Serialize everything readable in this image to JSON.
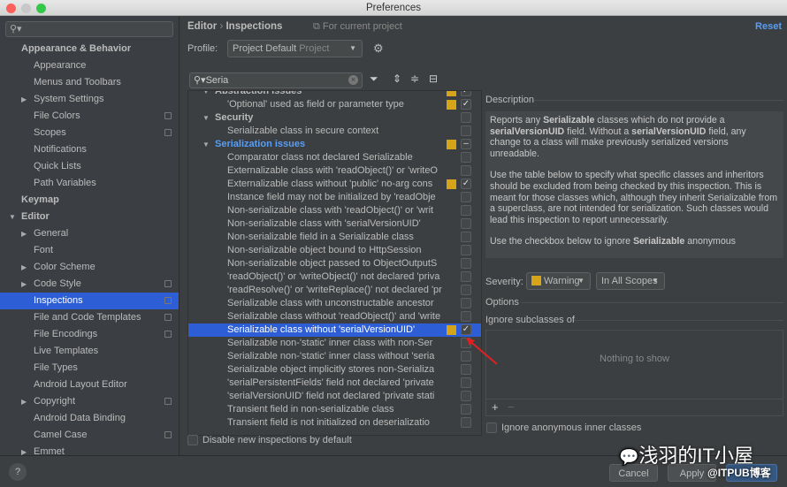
{
  "window": {
    "title": "Preferences"
  },
  "sidebar": {
    "search_placeholder": "",
    "items": [
      {
        "label": "Appearance & Behavior",
        "level": 0,
        "bold": true
      },
      {
        "label": "Appearance",
        "level": 1
      },
      {
        "label": "Menus and Toolbars",
        "level": 1
      },
      {
        "label": "System Settings",
        "level": 1,
        "expander": "closed"
      },
      {
        "label": "File Colors",
        "level": 1,
        "copy": true
      },
      {
        "label": "Scopes",
        "level": 1,
        "copy": true
      },
      {
        "label": "Notifications",
        "level": 1
      },
      {
        "label": "Quick Lists",
        "level": 1
      },
      {
        "label": "Path Variables",
        "level": 1
      },
      {
        "label": "Keymap",
        "level": 0,
        "bold": true
      },
      {
        "label": "Editor",
        "level": 0,
        "bold": true,
        "expander": "open"
      },
      {
        "label": "General",
        "level": 1,
        "expander": "closed"
      },
      {
        "label": "Font",
        "level": 1
      },
      {
        "label": "Color Scheme",
        "level": 1,
        "expander": "closed"
      },
      {
        "label": "Code Style",
        "level": 1,
        "expander": "closed",
        "copy": true
      },
      {
        "label": "Inspections",
        "level": 1,
        "copy": true,
        "selected": true
      },
      {
        "label": "File and Code Templates",
        "level": 1,
        "copy": true
      },
      {
        "label": "File Encodings",
        "level": 1,
        "copy": true
      },
      {
        "label": "Live Templates",
        "level": 1
      },
      {
        "label": "File Types",
        "level": 1
      },
      {
        "label": "Android Layout Editor",
        "level": 1
      },
      {
        "label": "Copyright",
        "level": 1,
        "expander": "closed",
        "copy": true
      },
      {
        "label": "Android Data Binding",
        "level": 1
      },
      {
        "label": "Camel Case",
        "level": 1,
        "copy": true
      },
      {
        "label": "Emmet",
        "level": 1,
        "expander": "closed"
      }
    ]
  },
  "header": {
    "crumb_parent": "Editor",
    "crumb_sep": "›",
    "crumb_current": "Inspections",
    "scope_hint": "For current project",
    "reset": "Reset"
  },
  "profile": {
    "label": "Profile:",
    "value": "Project Default",
    "scope": "Project"
  },
  "filter": {
    "search_value": "Seria"
  },
  "inspections": [
    {
      "label": "Abstraction issues",
      "group": true,
      "sev": true,
      "check": "✓"
    },
    {
      "label": "'Optional' used as field or parameter type",
      "sev": true,
      "check": "✓"
    },
    {
      "label": "Security",
      "group": true,
      "check": ""
    },
    {
      "label": "Serializable class in secure context",
      "check": ""
    },
    {
      "label": "Serialization issues",
      "group": true,
      "highlight": true,
      "sev": true,
      "check": "–"
    },
    {
      "label": "Comparator class not declared Serializable",
      "check": ""
    },
    {
      "label": "Externalizable class with 'readObject()' or 'writeO",
      "check": ""
    },
    {
      "label": "Externalizable class without 'public' no-arg cons",
      "sev": true,
      "check": "✓"
    },
    {
      "label": "Instance field may not be initialized by 'readObje",
      "check": ""
    },
    {
      "label": "Non-serializable class with 'readObject()' or 'writ",
      "check": ""
    },
    {
      "label": "Non-serializable class with 'serialVersionUID'",
      "check": ""
    },
    {
      "label": "Non-serializable field in a Serializable class",
      "check": ""
    },
    {
      "label": "Non-serializable object bound to HttpSession",
      "check": ""
    },
    {
      "label": "Non-serializable object passed to ObjectOutputS",
      "check": ""
    },
    {
      "label": "'readObject()' or 'writeObject()' not declared 'priva",
      "check": ""
    },
    {
      "label": "'readResolve()' or 'writeReplace()' not declared 'pr",
      "check": ""
    },
    {
      "label": "Serializable class with unconstructable ancestor",
      "check": ""
    },
    {
      "label": "Serializable class without 'readObject()' and 'write",
      "check": ""
    },
    {
      "label": "Serializable class without 'serialVersionUID'",
      "sev": true,
      "check": "✓",
      "selected": true
    },
    {
      "label": "Serializable non-'static' inner class with non-Ser",
      "check": ""
    },
    {
      "label": "Serializable non-'static' inner class without 'seria",
      "check": ""
    },
    {
      "label": "Serializable object implicitly stores non-Serializa",
      "check": ""
    },
    {
      "label": "'serialPersistentFields' field not declared 'private",
      "check": ""
    },
    {
      "label": "'serialVersionUID' field not declared 'private stati",
      "check": ""
    },
    {
      "label": "Transient field in non-serializable class",
      "check": ""
    },
    {
      "label": "Transient field is not initialized on deserializatio",
      "check": ""
    }
  ],
  "disable_new": "Disable new inspections by default",
  "description": {
    "title": "Description",
    "paragraphs": [
      [
        {
          "t": "Reports any "
        },
        {
          "t": "Serializable",
          "b": true
        },
        {
          "t": " classes which do not provide a "
        },
        {
          "t": "serialVersionUID",
          "b": true
        },
        {
          "t": " field. Without a "
        },
        {
          "t": "serialVersionUID",
          "b": true
        },
        {
          "t": " field, any change to a class will make previously serialized versions unreadable."
        }
      ],
      [
        {
          "t": "Use the table below to specify what specific classes and inheritors should be excluded from being checked by this inspection. This is meant for those classes which, although they inherit Serializable from a superclass, are not intended for serialization. Such classes would lead this inspection to report unnecessarily."
        }
      ],
      [
        {
          "t": "Use the checkbox below to ignore "
        },
        {
          "t": "Serializable",
          "b": true
        },
        {
          "t": " anonymous"
        }
      ]
    ]
  },
  "severity": {
    "label": "Severity:",
    "value": "Warning",
    "scope": "In All Scopes",
    "color": "#d6a419"
  },
  "options": {
    "title": "Options",
    "ignore_subclasses": "Ignore subclasses of",
    "empty": "Nothing to show",
    "add": "+",
    "remove": "−",
    "ignore_anonymous": "Ignore anonymous inner classes"
  },
  "buttons": {
    "help": "?",
    "cancel": "Cancel",
    "apply": "Apply"
  },
  "watermark": {
    "line1": "浅羽的IT小屋",
    "line2": "@ITPUB博客"
  }
}
